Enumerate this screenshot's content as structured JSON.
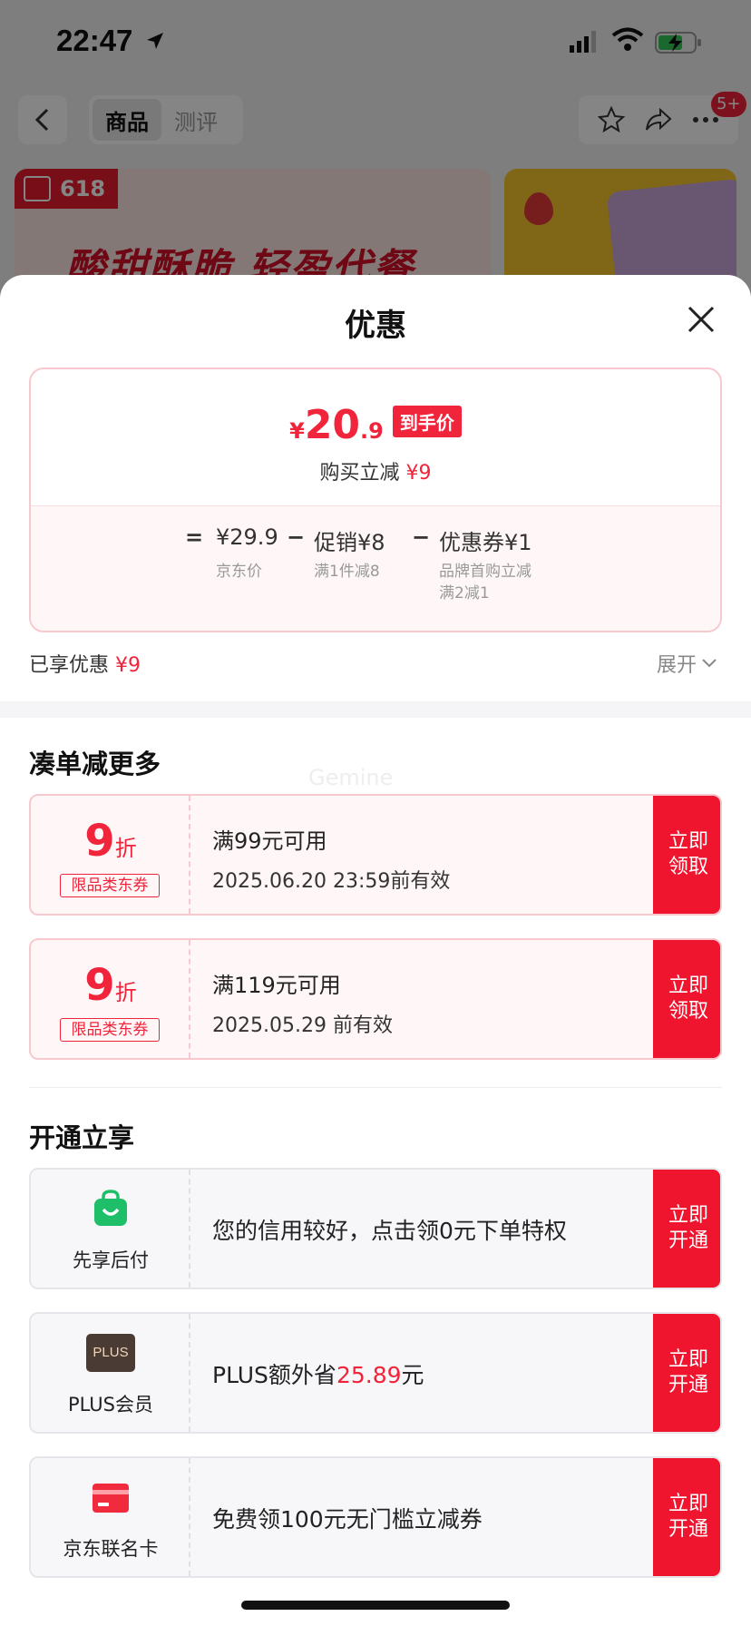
{
  "status_bar": {
    "time": "22:47"
  },
  "nav": {
    "tab_goods": "商品",
    "tab_review": "测评",
    "badge": "5+"
  },
  "banner": {
    "tag": "618",
    "headline": "酸甜酥脆 轻盈代餐"
  },
  "sheet": {
    "title": "优惠",
    "price": {
      "currency": "¥",
      "integer": "20",
      "decimal": ".9",
      "badge": "到手价",
      "reduce_label": "购买立减",
      "reduce_amount": "¥9"
    },
    "calc": {
      "eq": "=",
      "jd_price": "¥29.9",
      "jd_price_label": "京东价",
      "minus1": "−",
      "promo": "促销¥8",
      "promo_sub": "满1件减8",
      "minus2": "−",
      "coupon": "优惠券¥1",
      "coupon_sub1": "品牌首购立减",
      "coupon_sub2": "满2减1"
    },
    "enjoyed_label": "已享优惠",
    "enjoyed_amount": "¥9",
    "expand_label": "展开",
    "watermark": "Gemine"
  },
  "section_coupons": {
    "title": "凑单减更多",
    "items": [
      {
        "disc": "9",
        "unit": "折",
        "tag": "限品类东券",
        "main": "满99元可用",
        "sub": "2025.06.20 23:59前有效",
        "btn1": "立即",
        "btn2": "领取"
      },
      {
        "disc": "9",
        "unit": "折",
        "tag": "限品类东券",
        "main": "满119元可用",
        "sub": "2025.05.29 前有效",
        "btn1": "立即",
        "btn2": "领取"
      }
    ]
  },
  "section_open": {
    "title": "开通立享",
    "items": [
      {
        "label": "先享后付",
        "icon": "shopping-bag-icon",
        "text": "您的信用较好，点击领0元下单特权",
        "highlight": "",
        "suffix": "",
        "btn1": "立即",
        "btn2": "开通"
      },
      {
        "label": "PLUS会员",
        "icon": "plus-member-icon",
        "icon_text": "PLUS",
        "text": "PLUS额外省",
        "highlight": "25.89",
        "suffix": "元",
        "btn1": "立即",
        "btn2": "开通"
      },
      {
        "label": "京东联名卡",
        "icon": "credit-card-icon",
        "text": "免费领100元无门槛立减券",
        "highlight": "",
        "suffix": "",
        "btn1": "立即",
        "btn2": "开通"
      }
    ]
  },
  "colors": {
    "accent": "#f0243b",
    "button": "#f0152e",
    "coupon_bg": "#fff7f7",
    "coupon_border": "#f7c9cf"
  }
}
